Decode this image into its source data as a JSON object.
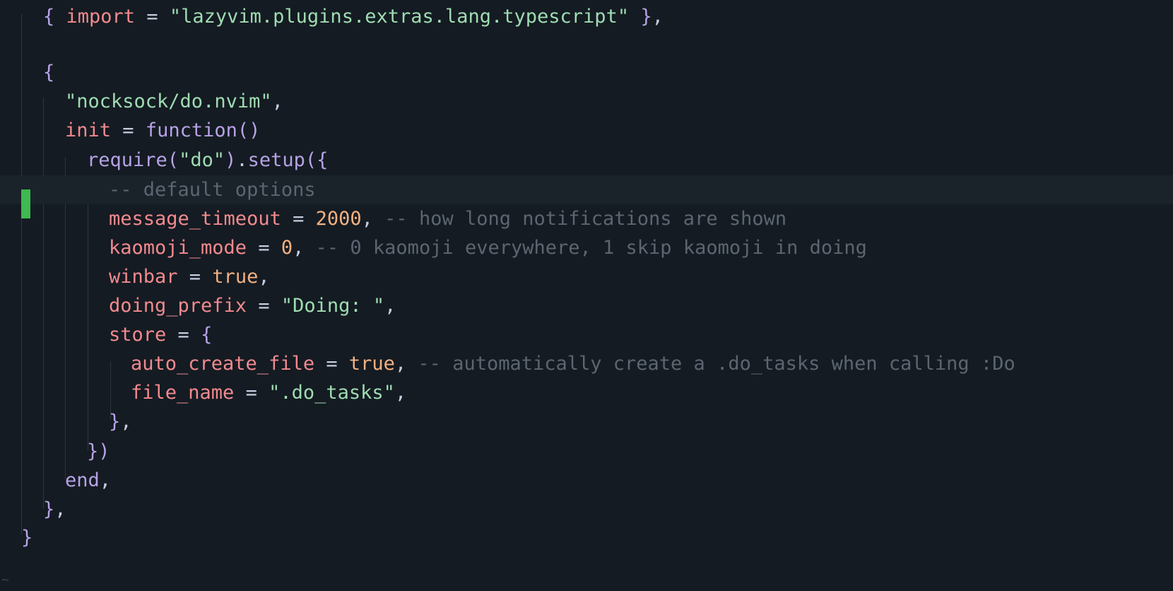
{
  "editor": {
    "lines": [
      [
        [
          "tk-br",
          "{"
        ],
        [
          "tk-punc",
          " "
        ],
        [
          "tk-var",
          "import"
        ],
        [
          "tk-punc",
          " = "
        ],
        [
          "tk-str",
          "\"lazyvim.plugins.extras.lang.typescript\""
        ],
        [
          "tk-punc",
          " "
        ],
        [
          "tk-br",
          "}"
        ],
        [
          "tk-punc",
          ","
        ]
      ],
      [],
      [
        [
          "tk-br",
          "{"
        ]
      ],
      [
        [
          "tk-str",
          "\"nocksock/do.nvim\""
        ],
        [
          "tk-punc",
          ","
        ]
      ],
      [
        [
          "tk-var",
          "init"
        ],
        [
          "tk-punc",
          " = "
        ],
        [
          "tk-kw",
          "function"
        ],
        [
          "tk-br",
          "()"
        ]
      ],
      [
        [
          "tk-fn",
          "require"
        ],
        [
          "tk-br",
          "("
        ],
        [
          "tk-str",
          "\"do\""
        ],
        [
          "tk-br",
          ")"
        ],
        [
          "tk-punc",
          "."
        ],
        [
          "tk-fn",
          "setup"
        ],
        [
          "tk-br",
          "({"
        ]
      ],
      [
        [
          "tk-cm",
          "-- default options"
        ]
      ],
      [
        [
          "tk-var",
          "message_timeout"
        ],
        [
          "tk-punc",
          " = "
        ],
        [
          "tk-num",
          "2000"
        ],
        [
          "tk-punc",
          ", "
        ],
        [
          "tk-cm",
          "-- how long notifications are shown"
        ]
      ],
      [
        [
          "tk-var",
          "kaomoji_mode"
        ],
        [
          "tk-punc",
          " = "
        ],
        [
          "tk-num",
          "0"
        ],
        [
          "tk-punc",
          ", "
        ],
        [
          "tk-cm",
          "-- 0 kaomoji everywhere, 1 skip kaomoji in doing"
        ]
      ],
      [
        [
          "tk-var",
          "winbar"
        ],
        [
          "tk-punc",
          " = "
        ],
        [
          "tk-bool",
          "true"
        ],
        [
          "tk-punc",
          ","
        ]
      ],
      [
        [
          "tk-var",
          "doing_prefix"
        ],
        [
          "tk-punc",
          " = "
        ],
        [
          "tk-str",
          "\"Doing: \""
        ],
        [
          "tk-punc",
          ","
        ]
      ],
      [
        [
          "tk-var",
          "store"
        ],
        [
          "tk-punc",
          " = "
        ],
        [
          "tk-br",
          "{"
        ]
      ],
      [
        [
          "tk-var",
          "auto_create_file"
        ],
        [
          "tk-punc",
          " = "
        ],
        [
          "tk-bool",
          "true"
        ],
        [
          "tk-punc",
          ", "
        ],
        [
          "tk-cm",
          "-- automatically create a .do_tasks when calling :Do"
        ]
      ],
      [
        [
          "tk-var",
          "file_name"
        ],
        [
          "tk-punc",
          " = "
        ],
        [
          "tk-str",
          "\".do_tasks\""
        ],
        [
          "tk-punc",
          ","
        ]
      ],
      [
        [
          "tk-br",
          "}"
        ],
        [
          "tk-punc",
          ","
        ]
      ],
      [
        [
          "tk-br",
          "})"
        ]
      ],
      [
        [
          "tk-kw",
          "end"
        ],
        [
          "tk-punc",
          ","
        ]
      ],
      [
        [
          "tk-br",
          "}"
        ],
        [
          "tk-punc",
          ","
        ]
      ],
      [
        [
          "tk-br",
          "}"
        ]
      ]
    ],
    "end_of_buffer_marker": "~"
  }
}
